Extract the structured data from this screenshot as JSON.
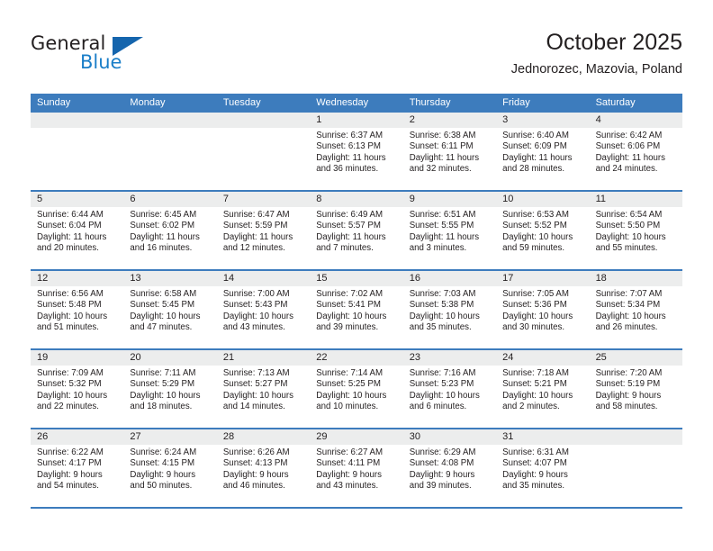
{
  "brand": {
    "name_top": "General",
    "name_bottom": "Blue",
    "logo_icon": "triangle-logo-icon",
    "accent_color": "#1a7ec8",
    "triangle_color": "#1565ad"
  },
  "header": {
    "title": "October 2025",
    "location": "Jednorozec, Mazovia, Poland"
  },
  "theme": {
    "header_blue": "#3d7cbd",
    "day_band_gray": "#eceded",
    "text": "#231f20"
  },
  "calendar": {
    "weekdays": [
      "Sunday",
      "Monday",
      "Tuesday",
      "Wednesday",
      "Thursday",
      "Friday",
      "Saturday"
    ],
    "weeks": [
      [
        {
          "day": "",
          "lines": []
        },
        {
          "day": "",
          "lines": []
        },
        {
          "day": "",
          "lines": []
        },
        {
          "day": "1",
          "lines": [
            "Sunrise: 6:37 AM",
            "Sunset: 6:13 PM",
            "Daylight: 11 hours",
            "and 36 minutes."
          ]
        },
        {
          "day": "2",
          "lines": [
            "Sunrise: 6:38 AM",
            "Sunset: 6:11 PM",
            "Daylight: 11 hours",
            "and 32 minutes."
          ]
        },
        {
          "day": "3",
          "lines": [
            "Sunrise: 6:40 AM",
            "Sunset: 6:09 PM",
            "Daylight: 11 hours",
            "and 28 minutes."
          ]
        },
        {
          "day": "4",
          "lines": [
            "Sunrise: 6:42 AM",
            "Sunset: 6:06 PM",
            "Daylight: 11 hours",
            "and 24 minutes."
          ]
        }
      ],
      [
        {
          "day": "5",
          "lines": [
            "Sunrise: 6:44 AM",
            "Sunset: 6:04 PM",
            "Daylight: 11 hours",
            "and 20 minutes."
          ]
        },
        {
          "day": "6",
          "lines": [
            "Sunrise: 6:45 AM",
            "Sunset: 6:02 PM",
            "Daylight: 11 hours",
            "and 16 minutes."
          ]
        },
        {
          "day": "7",
          "lines": [
            "Sunrise: 6:47 AM",
            "Sunset: 5:59 PM",
            "Daylight: 11 hours",
            "and 12 minutes."
          ]
        },
        {
          "day": "8",
          "lines": [
            "Sunrise: 6:49 AM",
            "Sunset: 5:57 PM",
            "Daylight: 11 hours",
            "and 7 minutes."
          ]
        },
        {
          "day": "9",
          "lines": [
            "Sunrise: 6:51 AM",
            "Sunset: 5:55 PM",
            "Daylight: 11 hours",
            "and 3 minutes."
          ]
        },
        {
          "day": "10",
          "lines": [
            "Sunrise: 6:53 AM",
            "Sunset: 5:52 PM",
            "Daylight: 10 hours",
            "and 59 minutes."
          ]
        },
        {
          "day": "11",
          "lines": [
            "Sunrise: 6:54 AM",
            "Sunset: 5:50 PM",
            "Daylight: 10 hours",
            "and 55 minutes."
          ]
        }
      ],
      [
        {
          "day": "12",
          "lines": [
            "Sunrise: 6:56 AM",
            "Sunset: 5:48 PM",
            "Daylight: 10 hours",
            "and 51 minutes."
          ]
        },
        {
          "day": "13",
          "lines": [
            "Sunrise: 6:58 AM",
            "Sunset: 5:45 PM",
            "Daylight: 10 hours",
            "and 47 minutes."
          ]
        },
        {
          "day": "14",
          "lines": [
            "Sunrise: 7:00 AM",
            "Sunset: 5:43 PM",
            "Daylight: 10 hours",
            "and 43 minutes."
          ]
        },
        {
          "day": "15",
          "lines": [
            "Sunrise: 7:02 AM",
            "Sunset: 5:41 PM",
            "Daylight: 10 hours",
            "and 39 minutes."
          ]
        },
        {
          "day": "16",
          "lines": [
            "Sunrise: 7:03 AM",
            "Sunset: 5:38 PM",
            "Daylight: 10 hours",
            "and 35 minutes."
          ]
        },
        {
          "day": "17",
          "lines": [
            "Sunrise: 7:05 AM",
            "Sunset: 5:36 PM",
            "Daylight: 10 hours",
            "and 30 minutes."
          ]
        },
        {
          "day": "18",
          "lines": [
            "Sunrise: 7:07 AM",
            "Sunset: 5:34 PM",
            "Daylight: 10 hours",
            "and 26 minutes."
          ]
        }
      ],
      [
        {
          "day": "19",
          "lines": [
            "Sunrise: 7:09 AM",
            "Sunset: 5:32 PM",
            "Daylight: 10 hours",
            "and 22 minutes."
          ]
        },
        {
          "day": "20",
          "lines": [
            "Sunrise: 7:11 AM",
            "Sunset: 5:29 PM",
            "Daylight: 10 hours",
            "and 18 minutes."
          ]
        },
        {
          "day": "21",
          "lines": [
            "Sunrise: 7:13 AM",
            "Sunset: 5:27 PM",
            "Daylight: 10 hours",
            "and 14 minutes."
          ]
        },
        {
          "day": "22",
          "lines": [
            "Sunrise: 7:14 AM",
            "Sunset: 5:25 PM",
            "Daylight: 10 hours",
            "and 10 minutes."
          ]
        },
        {
          "day": "23",
          "lines": [
            "Sunrise: 7:16 AM",
            "Sunset: 5:23 PM",
            "Daylight: 10 hours",
            "and 6 minutes."
          ]
        },
        {
          "day": "24",
          "lines": [
            "Sunrise: 7:18 AM",
            "Sunset: 5:21 PM",
            "Daylight: 10 hours",
            "and 2 minutes."
          ]
        },
        {
          "day": "25",
          "lines": [
            "Sunrise: 7:20 AM",
            "Sunset: 5:19 PM",
            "Daylight: 9 hours",
            "and 58 minutes."
          ]
        }
      ],
      [
        {
          "day": "26",
          "lines": [
            "Sunrise: 6:22 AM",
            "Sunset: 4:17 PM",
            "Daylight: 9 hours",
            "and 54 minutes."
          ]
        },
        {
          "day": "27",
          "lines": [
            "Sunrise: 6:24 AM",
            "Sunset: 4:15 PM",
            "Daylight: 9 hours",
            "and 50 minutes."
          ]
        },
        {
          "day": "28",
          "lines": [
            "Sunrise: 6:26 AM",
            "Sunset: 4:13 PM",
            "Daylight: 9 hours",
            "and 46 minutes."
          ]
        },
        {
          "day": "29",
          "lines": [
            "Sunrise: 6:27 AM",
            "Sunset: 4:11 PM",
            "Daylight: 9 hours",
            "and 43 minutes."
          ]
        },
        {
          "day": "30",
          "lines": [
            "Sunrise: 6:29 AM",
            "Sunset: 4:08 PM",
            "Daylight: 9 hours",
            "and 39 minutes."
          ]
        },
        {
          "day": "31",
          "lines": [
            "Sunrise: 6:31 AM",
            "Sunset: 4:07 PM",
            "Daylight: 9 hours",
            "and 35 minutes."
          ]
        },
        {
          "day": "",
          "lines": []
        }
      ]
    ]
  }
}
